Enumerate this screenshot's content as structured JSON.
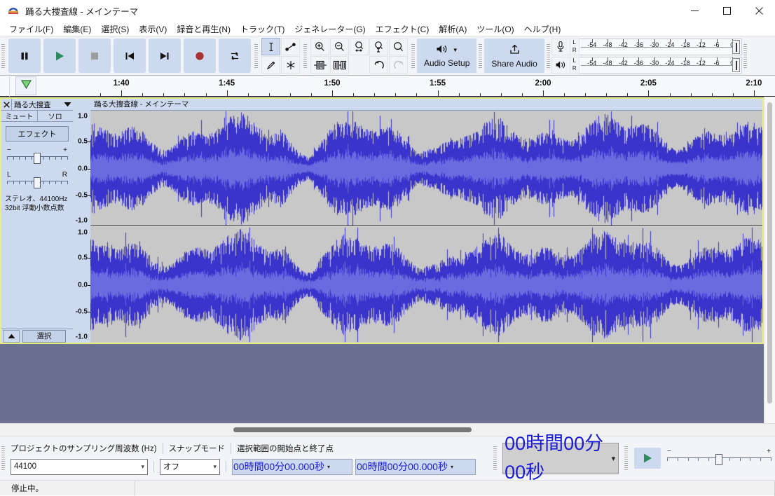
{
  "window": {
    "title": "踊る大捜査線 - メインテーマ",
    "logo_icon": "audacity-logo-icon",
    "minimize_label": "—",
    "maximize_label": "☐",
    "close_label": "✕"
  },
  "menubar": {
    "items": [
      {
        "label": "ファイル(F)",
        "name": "menu-file"
      },
      {
        "label": "編集(E)",
        "name": "menu-edit"
      },
      {
        "label": "選択(S)",
        "name": "menu-select"
      },
      {
        "label": "表示(V)",
        "name": "menu-view"
      },
      {
        "label": "録音と再生(N)",
        "name": "menu-transport"
      },
      {
        "label": "トラック(T)",
        "name": "menu-tracks"
      },
      {
        "label": "ジェネレーター(G)",
        "name": "menu-generate"
      },
      {
        "label": "エフェクト(C)",
        "name": "menu-effect"
      },
      {
        "label": "解析(A)",
        "name": "menu-analyze"
      },
      {
        "label": "ツール(O)",
        "name": "menu-tools"
      },
      {
        "label": "ヘルプ(H)",
        "name": "menu-help"
      }
    ]
  },
  "transport": {
    "buttons": [
      {
        "name": "pause-button",
        "icon": "pause-icon"
      },
      {
        "name": "play-button",
        "icon": "play-icon"
      },
      {
        "name": "stop-button",
        "icon": "stop-icon"
      },
      {
        "name": "skip-to-start-button",
        "icon": "skip-start-icon"
      },
      {
        "name": "skip-to-end-button",
        "icon": "skip-end-icon"
      },
      {
        "name": "record-button",
        "icon": "record-icon"
      },
      {
        "name": "loop-button",
        "icon": "loop-icon"
      }
    ]
  },
  "tools": {
    "buttons": [
      {
        "name": "selection-tool",
        "icon": "i-beam-icon",
        "selected": true
      },
      {
        "name": "envelope-tool",
        "icon": "envelope-icon",
        "selected": false
      },
      {
        "name": "draw-tool",
        "icon": "pencil-icon",
        "selected": false
      },
      {
        "name": "multi-tool",
        "icon": "asterisk-icon",
        "selected": false
      }
    ]
  },
  "edit_toolbar": {
    "buttons": [
      {
        "name": "zoom-in-button",
        "icon": "zoom-in-icon"
      },
      {
        "name": "zoom-out-button",
        "icon": "zoom-out-icon"
      },
      {
        "name": "fit-selection-button",
        "icon": "fit-selection-icon"
      },
      {
        "name": "fit-project-button",
        "icon": "fit-project-icon"
      },
      {
        "name": "zoom-toggle-button",
        "icon": "zoom-toggle-icon"
      },
      {
        "name": "trim-outside-selection-button",
        "icon": "trim-audio-icon"
      },
      {
        "name": "silence-selection-button",
        "icon": "silence-audio-icon"
      },
      {
        "name": "spacer",
        "icon": "none"
      },
      {
        "name": "undo-button",
        "icon": "undo-icon"
      },
      {
        "name": "redo-button",
        "icon": "redo-icon"
      }
    ]
  },
  "audio_setup": {
    "label": "Audio Setup",
    "icon": "speaker-icon",
    "caret": "▼"
  },
  "share_audio": {
    "label": "Share Audio",
    "icon": "upload-icon"
  },
  "meters": {
    "record": {
      "icon": "microphone-icon",
      "left_label": "L",
      "right_label": "R"
    },
    "play": {
      "icon": "speaker-icon",
      "left_label": "L",
      "right_label": "R"
    },
    "scale_labels": [
      "-54",
      "-48",
      "-42",
      "-36",
      "-30",
      "-24",
      "-18",
      "-12",
      "-6",
      "0"
    ]
  },
  "timeline": {
    "pin_icon": "pinned-play-head-icon",
    "major_labels": [
      "1:40",
      "1:45",
      "1:50",
      "1:55",
      "2:00",
      "2:05",
      "2:10"
    ],
    "start_seconds": 98.5,
    "end_seconds": 131.0
  },
  "track": {
    "close_icon": "close-icon",
    "name": "踊る大捜査",
    "menu_caret_icon": "chevron-down-icon",
    "mute_label": "ミュート",
    "solo_label": "ソロ",
    "effects_label": "エフェクト",
    "gain_minus": "−",
    "gain_plus": "+",
    "pan_left": "L",
    "pan_right": "R",
    "info_line1": "ステレオ、44100Hz",
    "info_line2": "32bit 浮動小数点数",
    "collapse_icon": "collapse-up-icon",
    "select_label": "選択",
    "clip_title": "踊る大捜査線 - メインテーマ",
    "vruler_labels": [
      "1.0",
      "0.5",
      "0.0",
      "-0.5",
      "-1.0"
    ],
    "waveform_color": "#3a33cc",
    "rms_color": "#6b6be0",
    "background_color": "#c8c8c8",
    "selected_border_color": "#e9ee82"
  },
  "selection_toolbar": {
    "rate_label": "プロジェクトのサンプリング周波数 (Hz)",
    "rate_value": "44100",
    "snap_label": "スナップモード",
    "snap_value": "オフ",
    "range_label": "選択範囲の開始点と終了点",
    "start_time": "00時間00分00.000秒",
    "end_time": "00時間00分00.000秒"
  },
  "time_toolbar": {
    "value": "00時間00分00秒"
  },
  "play_speed": {
    "play_icon": "play-icon",
    "minus": "−",
    "plus": "+",
    "value_percent": 100
  },
  "statusbar": {
    "message": "停止中。"
  }
}
